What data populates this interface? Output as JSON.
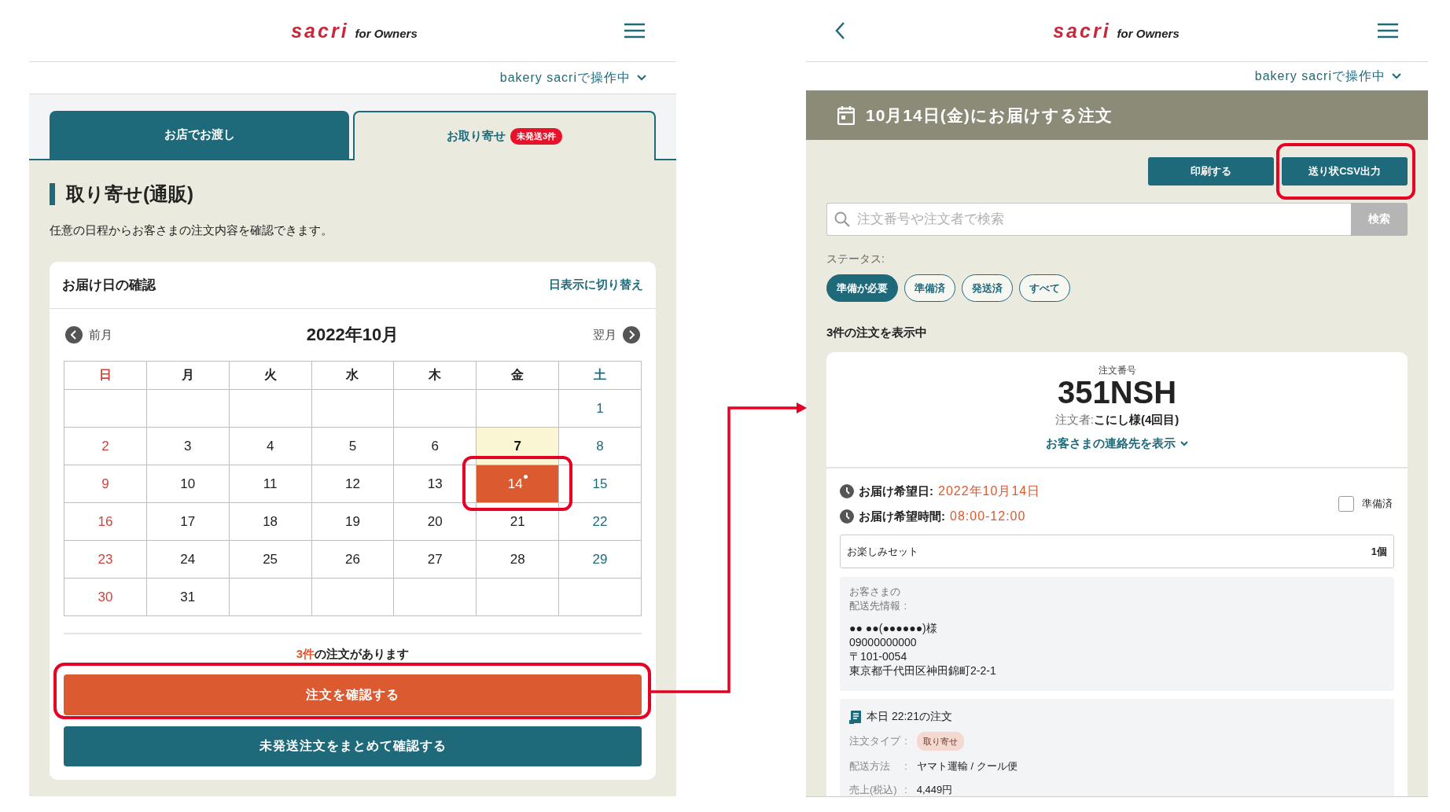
{
  "left_screen": {
    "header": {
      "wordmark": "sacri",
      "tagline": "for Owners"
    },
    "operator": "bakery sacriで操作中",
    "tabs": [
      {
        "label": "お店でお渡し",
        "selected": false
      },
      {
        "label": "お取り寄せ",
        "selected": true,
        "badge": "未発送3件"
      }
    ],
    "title": "取り寄せ(通販)",
    "description": "任意の日程からお客さまの注文内容を確認できます。",
    "calendar": {
      "title": "お届け日の確認",
      "switch_link": "日表示に切り替え",
      "prev": "前月",
      "month": "2022年10月",
      "next": "翌月",
      "weekdays": [
        {
          "label": "日",
          "kind": "sunday"
        },
        {
          "label": "月",
          "kind": "weekday"
        },
        {
          "label": "火",
          "kind": "weekday"
        },
        {
          "label": "水",
          "kind": "weekday"
        },
        {
          "label": "木",
          "kind": "weekday"
        },
        {
          "label": "金",
          "kind": "weekday"
        },
        {
          "label": "土",
          "kind": "saturday"
        }
      ],
      "weeks": [
        [
          {
            "kind": "blank"
          },
          {
            "kind": "blank"
          },
          {
            "kind": "blank"
          },
          {
            "kind": "blank"
          },
          {
            "kind": "blank"
          },
          {
            "kind": "blank"
          },
          {
            "kind": "day",
            "day": "1",
            "today": false,
            "selected": false,
            "marked": false
          }
        ],
        [
          {
            "kind": "day",
            "day": "2",
            "today": false,
            "selected": false,
            "marked": false
          },
          {
            "kind": "day",
            "day": "3",
            "today": false,
            "selected": false,
            "marked": false
          },
          {
            "kind": "day",
            "day": "4",
            "today": false,
            "selected": false,
            "marked": false
          },
          {
            "kind": "day",
            "day": "5",
            "today": false,
            "selected": false,
            "marked": false
          },
          {
            "kind": "day",
            "day": "6",
            "today": false,
            "selected": false,
            "marked": false
          },
          {
            "kind": "day",
            "day": "7",
            "today": true,
            "selected": false,
            "marked": false
          },
          {
            "kind": "day",
            "day": "8",
            "today": false,
            "selected": false,
            "marked": false
          }
        ],
        [
          {
            "kind": "day",
            "day": "9",
            "today": false,
            "selected": false,
            "marked": false
          },
          {
            "kind": "day",
            "day": "10",
            "today": false,
            "selected": false,
            "marked": false
          },
          {
            "kind": "day",
            "day": "11",
            "today": false,
            "selected": false,
            "marked": false
          },
          {
            "kind": "day",
            "day": "12",
            "today": false,
            "selected": false,
            "marked": false
          },
          {
            "kind": "day",
            "day": "13",
            "today": false,
            "selected": false,
            "marked": false
          },
          {
            "kind": "day",
            "day": "14",
            "today": false,
            "selected": true,
            "marked": true
          },
          {
            "kind": "day",
            "day": "15",
            "today": false,
            "selected": false,
            "marked": false
          }
        ],
        [
          {
            "kind": "day",
            "day": "16",
            "today": false,
            "selected": false,
            "marked": false
          },
          {
            "kind": "day",
            "day": "17",
            "today": false,
            "selected": false,
            "marked": false
          },
          {
            "kind": "day",
            "day": "18",
            "today": false,
            "selected": false,
            "marked": false
          },
          {
            "kind": "day",
            "day": "19",
            "today": false,
            "selected": false,
            "marked": false
          },
          {
            "kind": "day",
            "day": "20",
            "today": false,
            "selected": false,
            "marked": false
          },
          {
            "kind": "day",
            "day": "21",
            "today": false,
            "selected": false,
            "marked": false
          },
          {
            "kind": "day",
            "day": "22",
            "today": false,
            "selected": false,
            "marked": false
          }
        ],
        [
          {
            "kind": "day",
            "day": "23",
            "today": false,
            "selected": false,
            "marked": false
          },
          {
            "kind": "day",
            "day": "24",
            "today": false,
            "selected": false,
            "marked": false
          },
          {
            "kind": "day",
            "day": "25",
            "today": false,
            "selected": false,
            "marked": false
          },
          {
            "kind": "day",
            "day": "26",
            "today": false,
            "selected": false,
            "marked": false
          },
          {
            "kind": "day",
            "day": "27",
            "today": false,
            "selected": false,
            "marked": false
          },
          {
            "kind": "day",
            "day": "28",
            "today": false,
            "selected": false,
            "marked": false
          },
          {
            "kind": "day",
            "day": "29",
            "today": false,
            "selected": false,
            "marked": false
          }
        ],
        [
          {
            "kind": "day",
            "day": "30",
            "today": false,
            "selected": false,
            "marked": false
          },
          {
            "kind": "day",
            "day": "31",
            "today": false,
            "selected": false,
            "marked": false
          },
          {
            "kind": "blank"
          },
          {
            "kind": "blank"
          },
          {
            "kind": "blank"
          },
          {
            "kind": "blank"
          },
          {
            "kind": "blank"
          }
        ]
      ]
    },
    "order_count": "3件",
    "order_count_suffix": "の注文があります",
    "confirm_button": "注文を確認する",
    "bulk_button": "未発送注文をまとめて確認する"
  },
  "right_screen": {
    "header": {
      "wordmark": "sacri",
      "tagline": "for Owners"
    },
    "operator": "bakery sacriで操作中",
    "date_banner": "10月14日(金)にお届けする注文",
    "actions": [
      "印刷する",
      "送り状CSV出力"
    ],
    "search": {
      "placeholder": "注文番号や注文者で検索",
      "button": "検索"
    },
    "status_label": "ステータス:",
    "status_filters": [
      {
        "label": "準備が必要",
        "selected": true
      },
      {
        "label": "準備済",
        "selected": false
      },
      {
        "label": "発送済",
        "selected": false
      },
      {
        "label": "すべて",
        "selected": false
      }
    ],
    "result_count": "3件の注文を表示中",
    "order": {
      "number_label": "注文番号",
      "number": "351NSH",
      "orderer_label": "注文者:",
      "orderer": "こにし様(4回目)",
      "contact_link": "お客さまの連絡先を表示",
      "delivery": [
        {
          "label": "お届け希望日:",
          "value": "2022年10月14日"
        },
        {
          "label": "お届け希望時間:",
          "value": "08:00-12:00"
        }
      ],
      "prepared": {
        "label": "準備済",
        "checked": false
      },
      "items": [
        {
          "name": "お楽しみセット",
          "quantity": "1個"
        }
      ],
      "shipping": {
        "label": "お客さまの配送先情報",
        "separator": ":",
        "lines": [
          "●● ●●(●●●●●●)様",
          "09000000000",
          "〒101-0054",
          "東京都千代田区神田錦町2-2-1"
        ]
      },
      "info": {
        "title": "本日 22:21の注文",
        "rows": [
          {
            "label": "注文タイプ",
            "separator": ":",
            "value": "取り寄せ",
            "kind": "tag"
          },
          {
            "label": "配送方法",
            "separator": ":",
            "value": "ヤマト運輸 / クール便",
            "kind": "text"
          },
          {
            "label": "売上(税込)",
            "separator": ":",
            "value": "4,449円",
            "kind": "text"
          }
        ]
      }
    }
  }
}
